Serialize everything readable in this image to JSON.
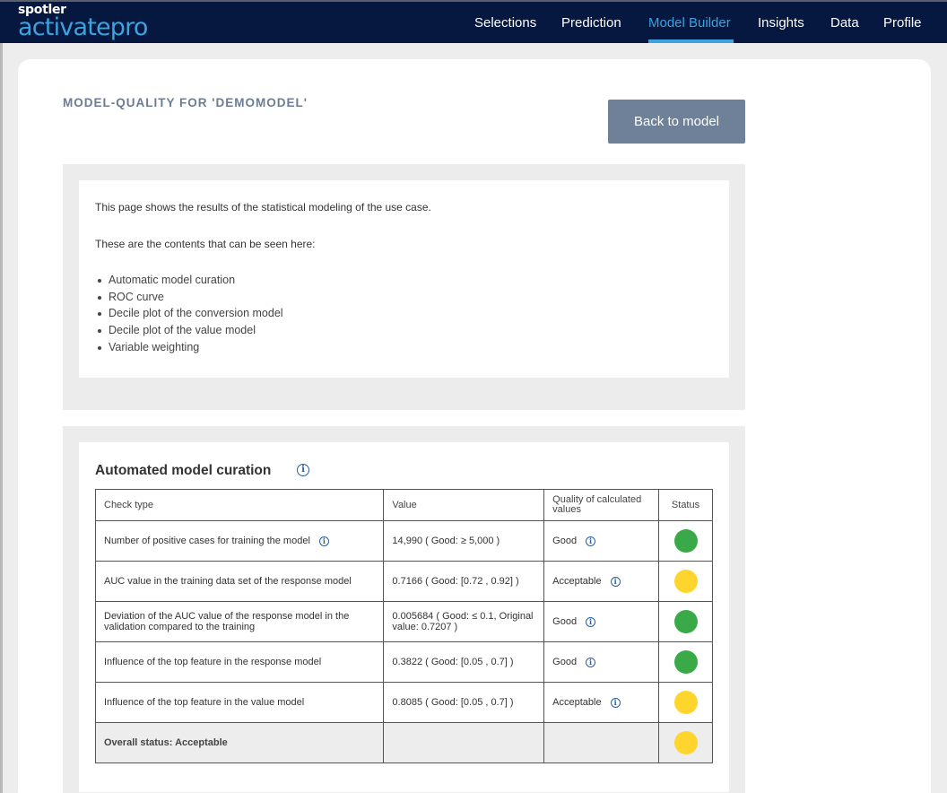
{
  "header": {
    "logo_top": "spotler",
    "logo_main": "activatepro",
    "nav": [
      {
        "label": "Selections",
        "active": false
      },
      {
        "label": "Prediction",
        "active": false
      },
      {
        "label": "Model Builder",
        "active": true
      },
      {
        "label": "Insights",
        "active": false
      },
      {
        "label": "Data",
        "active": false
      },
      {
        "label": "Profile",
        "active": false
      }
    ],
    "accent": "#3aa3e0",
    "bg": "#06183f"
  },
  "page": {
    "title": "MODEL-QUALITY FOR 'DEMOMODEL'",
    "back_button": "Back to model"
  },
  "intro": {
    "line1": "This page shows the results of the statistical modeling of the use case.",
    "line2": "These are the contents that can be seen here:",
    "bullets": [
      "Automatic model curation",
      "ROC curve",
      "Decile plot of the conversion model",
      "Decile plot of the value model",
      "Variable weighting"
    ]
  },
  "curation": {
    "title": "Automated model curation",
    "info_icon": "info-icon",
    "columns": [
      "Check type",
      "Value",
      "Quality of calculated values",
      "Status"
    ],
    "rows": [
      {
        "check": "Number of positive cases for training the model",
        "check_info": true,
        "value": "14,990 ( Good: ≥ 5,000 )",
        "quality": "Good",
        "status": "green"
      },
      {
        "check": "AUC value in the training data set of the response model",
        "check_info": false,
        "value": "0.7166 ( Good: [0.72 , 0.92] )",
        "quality": "Acceptable",
        "status": "yellow"
      },
      {
        "check": "Deviation of the AUC value of the response model in the validation compared to the training",
        "check_info": false,
        "value": "0.005684 ( Good: ≤ 0.1, Original value: 0.7207 )",
        "quality": "Good",
        "status": "green"
      },
      {
        "check": "Influence of the top feature in the response model",
        "check_info": false,
        "value": "0.3822 ( Good: [0.05 , 0.7] )",
        "quality": "Good",
        "status": "green"
      },
      {
        "check": "Influence of the top feature in the value model",
        "check_info": false,
        "value": "0.8085 ( Good: [0.05 , 0.7] )",
        "quality": "Acceptable",
        "status": "yellow"
      }
    ],
    "overall": {
      "label": "Overall status: Acceptable",
      "status": "yellow"
    },
    "status_colors": {
      "green": "#3aaa48",
      "yellow": "#fdd52d"
    }
  }
}
